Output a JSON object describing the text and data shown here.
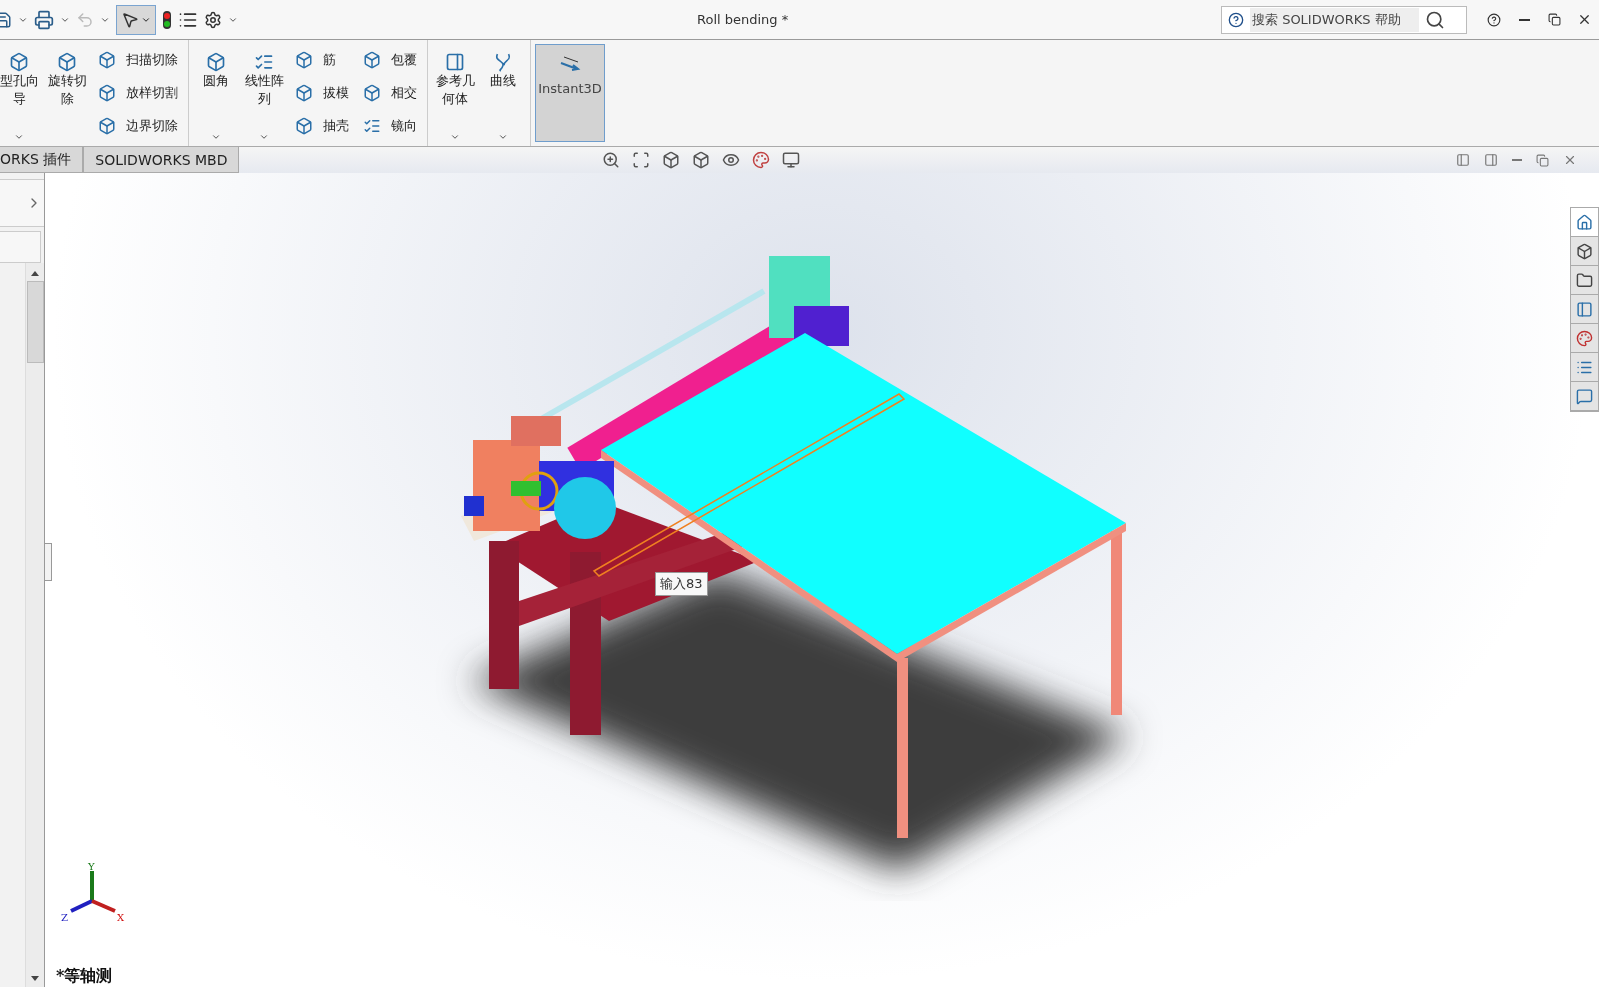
{
  "window": {
    "title": "Roll bending *"
  },
  "search": {
    "placeholder": "搜索 SOLIDWORKS 帮助"
  },
  "ribbon": {
    "groups": [
      {
        "items": [
          {
            "kind": "large",
            "label": "型孔向导",
            "dropdown": true
          },
          {
            "kind": "large",
            "label": "旋转切除",
            "dropdown": false
          },
          {
            "kind": "stack",
            "entries": [
              {
                "label": "扫描切除"
              },
              {
                "label": "放样切割"
              },
              {
                "label": "边界切除"
              }
            ]
          }
        ]
      },
      {
        "items": [
          {
            "kind": "large",
            "label": "圆角",
            "dropdown": true
          },
          {
            "kind": "large",
            "label": "线性阵列",
            "dropdown": true
          },
          {
            "kind": "stack",
            "entries": [
              {
                "label": "筋"
              },
              {
                "label": "拔模"
              },
              {
                "label": "抽壳"
              }
            ]
          },
          {
            "kind": "stack",
            "entries": [
              {
                "label": "包覆"
              },
              {
                "label": "相交"
              },
              {
                "label": "镜向"
              }
            ]
          }
        ]
      },
      {
        "items": [
          {
            "kind": "large",
            "label": "参考几何体",
            "dropdown": true
          },
          {
            "kind": "large",
            "label": "曲线",
            "dropdown": true
          }
        ]
      },
      {
        "items": [
          {
            "kind": "toggle",
            "label": "Instant3D",
            "selected": true
          }
        ]
      }
    ]
  },
  "tabs": [
    {
      "label": "ORKS 插件",
      "selected": false
    },
    {
      "label": "SOLIDWORKS MBD",
      "selected": false
    }
  ],
  "viewport": {
    "tooltip": "输入83",
    "view_name": "*等轴测",
    "triad": {
      "x": "X",
      "y": "Y",
      "z": "Z"
    }
  }
}
